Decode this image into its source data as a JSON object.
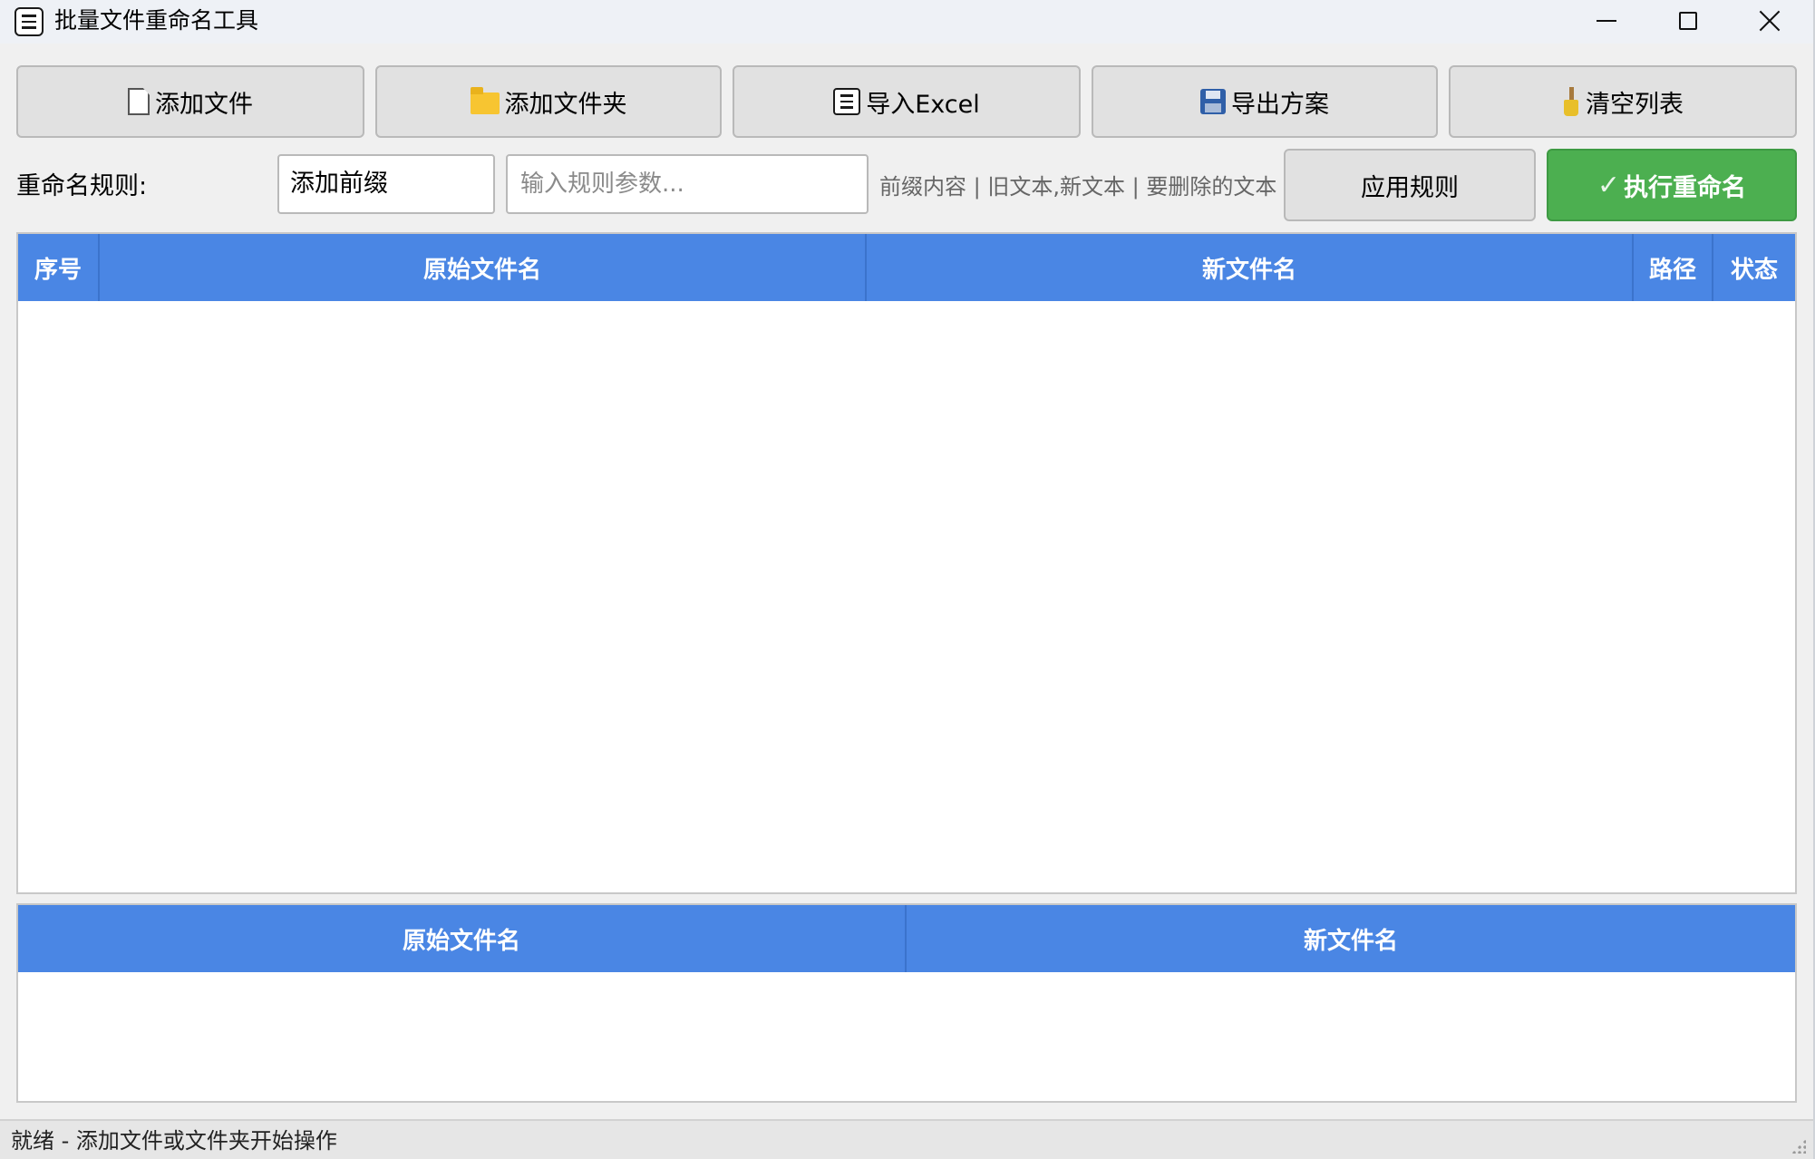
{
  "window": {
    "title": "批量文件重命名工具",
    "icon": "document-icon"
  },
  "toolbar": {
    "add_file": {
      "label": "添加文件",
      "icon": "file-icon"
    },
    "add_folder": {
      "label": "添加文件夹",
      "icon": "folder-icon"
    },
    "import_excel": {
      "label": "导入Excel",
      "icon": "document-icon"
    },
    "export_scheme": {
      "label": "导出方案",
      "icon": "save-icon"
    },
    "clear_list": {
      "label": "清空列表",
      "icon": "broom-icon"
    }
  },
  "rule": {
    "label": "重命名规则:",
    "selected": "添加前缀",
    "param_placeholder": "输入规则参数...",
    "param_value": "",
    "hint": "前缀内容 | 旧文本,新文本 | 要删除的文本",
    "apply_label": "应用规则",
    "execute_label": "执行重命名",
    "execute_icon": "✓",
    "execute_color": "#4caf50"
  },
  "main_table": {
    "header_color": "#4a86e4",
    "columns": [
      "序号",
      "原始文件名",
      "新文件名",
      "路径",
      "状态"
    ],
    "rows": []
  },
  "preview_table": {
    "columns": [
      "原始文件名",
      "新文件名"
    ],
    "rows": []
  },
  "status": {
    "text": "就绪 - 添加文件或文件夹开始操作"
  }
}
